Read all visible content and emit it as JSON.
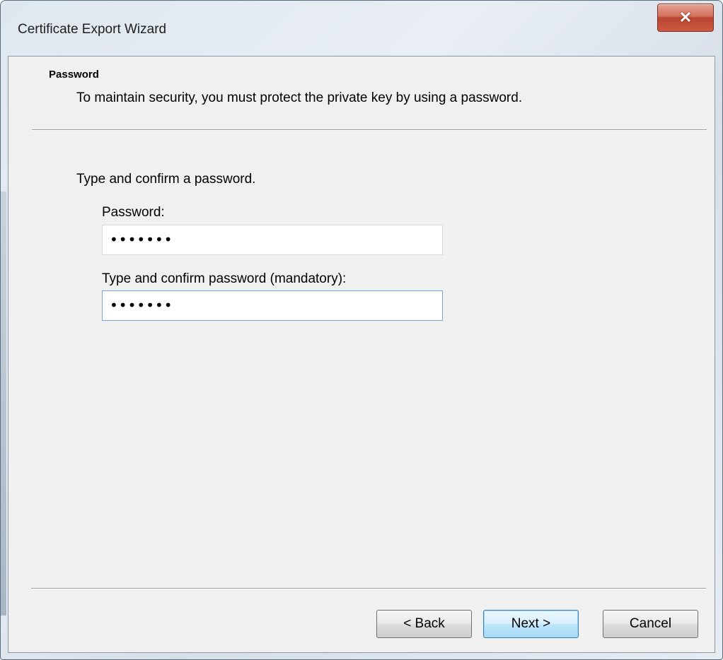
{
  "window": {
    "title": "Certificate Export Wizard"
  },
  "header": {
    "title": "Password",
    "description": "To maintain security, you must protect the private key by using a password."
  },
  "body": {
    "instruction": "Type and confirm a password.",
    "password_label": "Password:",
    "password_value": "•••••••",
    "confirm_label": "Type and confirm password (mandatory):",
    "confirm_value": "•••••••"
  },
  "buttons": {
    "back": "< Back",
    "next": "Next >",
    "cancel": "Cancel"
  },
  "icons": {
    "close": "close-icon"
  }
}
